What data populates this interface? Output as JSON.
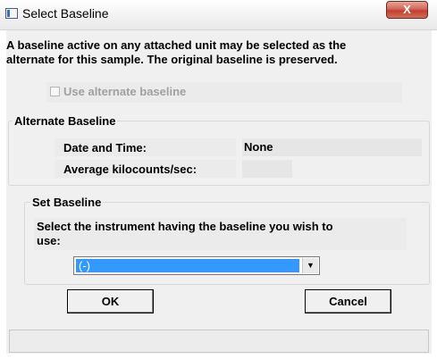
{
  "window": {
    "title": "Select Baseline",
    "close_glyph": "X"
  },
  "message": {
    "line1": "A baseline active on any attached unit may be selected as the",
    "line2": "alternate for this sample.  The original baseline is preserved."
  },
  "use_alternate": {
    "label": "Use alternate baseline",
    "checked": false,
    "enabled": false
  },
  "alternate_group": {
    "title": "Alternate Baseline",
    "date_label": "Date and Time:",
    "date_value": "None",
    "avg_label": "Average kilocounts/sec:",
    "avg_value": ""
  },
  "set_group": {
    "title": "Set Baseline",
    "prompt_line1": "Select the instrument having the baseline you wish to",
    "prompt_line2": "use:",
    "selected_instrument": "(-)"
  },
  "buttons": {
    "ok": "OK",
    "cancel": "Cancel"
  },
  "colors": {
    "selection": "#3399ff",
    "close_button": "#c94a3a",
    "dialog_bg": "#f0f0f0"
  }
}
